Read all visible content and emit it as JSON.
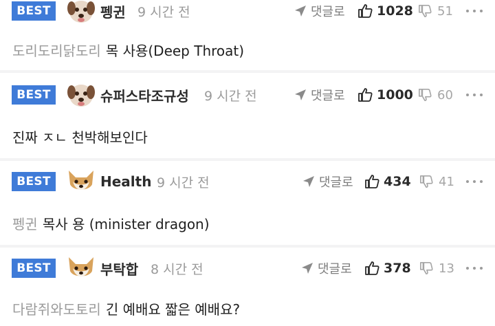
{
  "comments": [
    {
      "badge": "BEST",
      "nick": "펭귄",
      "time": "9 시간 전",
      "reply": "댓글로",
      "likes": "1028",
      "dislikes": "51",
      "mention": "도리도리닭도리",
      "text": "목 사용(Deep Throat)",
      "avatar": "dog-avatar-icon"
    },
    {
      "badge": "BEST",
      "nick": "슈퍼스타조규성",
      "time": "9 시간 전",
      "reply": "댓글로",
      "likes": "1000",
      "dislikes": "60",
      "mention": "",
      "text": "진짜 ㅈㄴ 천박해보인다",
      "avatar": "dog-avatar-icon"
    },
    {
      "badge": "BEST",
      "nick": "Health",
      "time": "9 시간 전",
      "reply": "댓글로",
      "likes": "434",
      "dislikes": "41",
      "mention": "펭귄",
      "text": "목사 용 (minister dragon)",
      "avatar": "shiba-avatar-icon"
    },
    {
      "badge": "BEST",
      "nick": "부탁합",
      "time": "8 시간 전",
      "reply": "댓글로",
      "likes": "378",
      "dislikes": "13",
      "mention": "다람쥐와도토리",
      "text": "긴 예배요 짧은 예배요?",
      "avatar": "shiba-avatar-icon"
    }
  ],
  "colors": {
    "badge": "#3f7bd8",
    "background": "#f3f3f4",
    "card": "#ffffff"
  }
}
